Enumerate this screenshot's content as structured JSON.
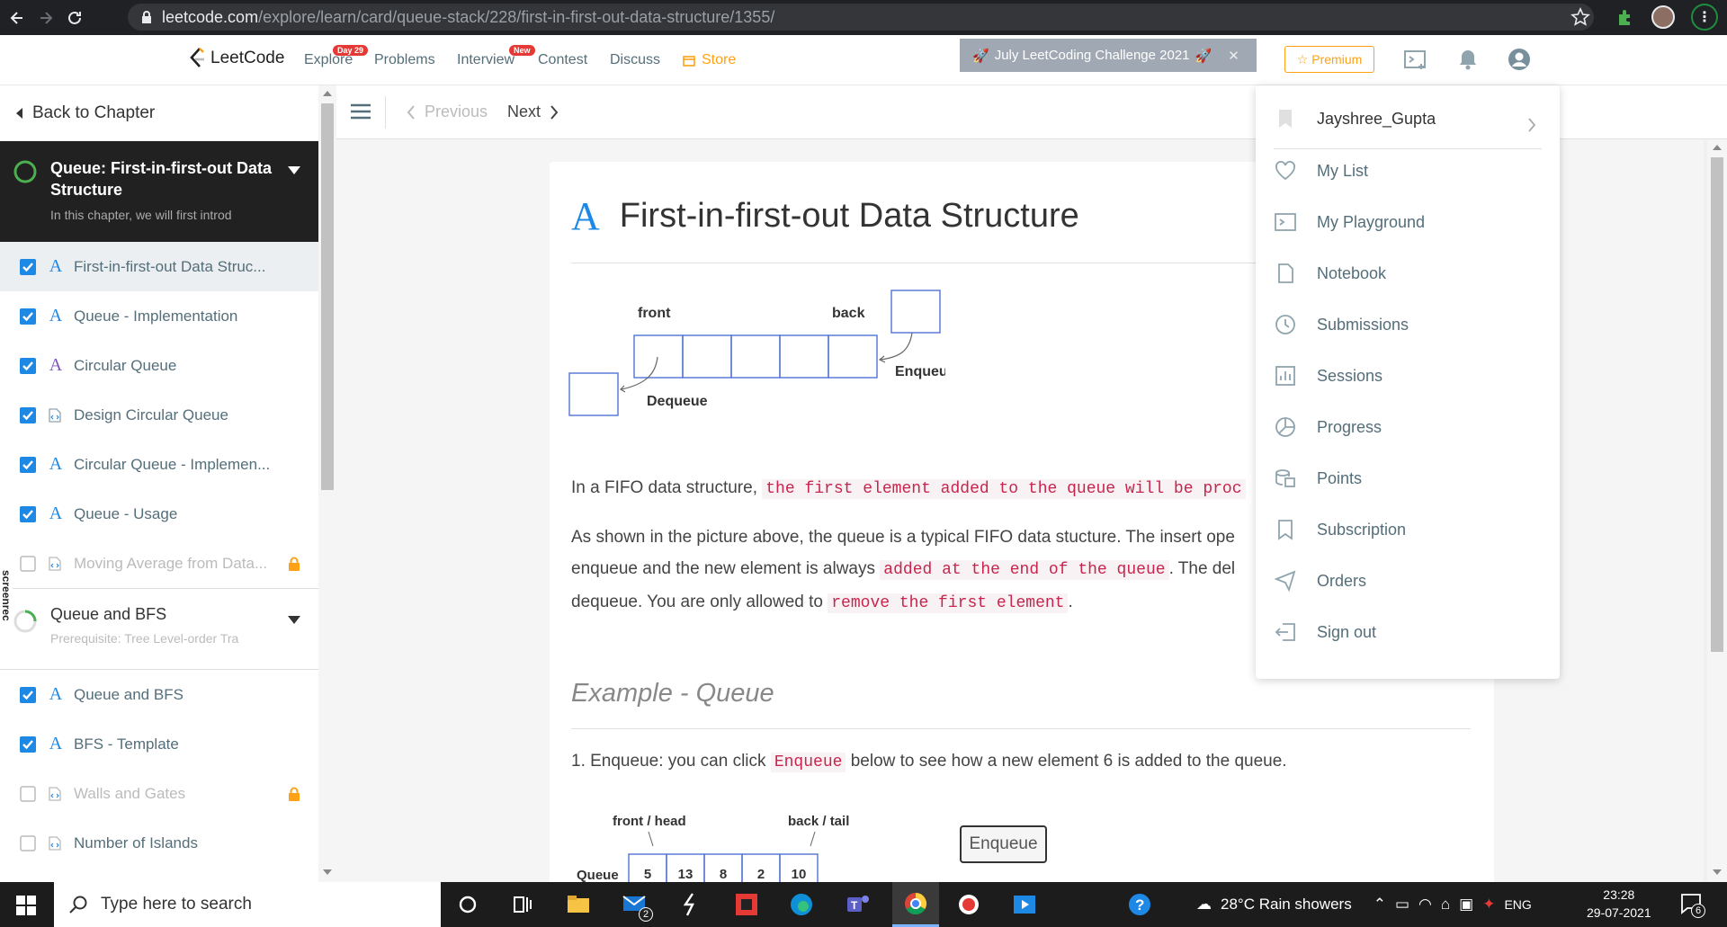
{
  "browser": {
    "url_host": "leetcode.com",
    "url_path": "/explore/learn/card/queue-stack/228/first-in-first-out-data-structure/1355/"
  },
  "nav": {
    "logo": "LeetCode",
    "items": [
      {
        "label": "Explore",
        "badge": "Day 29"
      },
      {
        "label": "Problems"
      },
      {
        "label": "Interview",
        "badge": "New"
      },
      {
        "label": "Contest"
      },
      {
        "label": "Discuss"
      },
      {
        "label": "Store"
      }
    ],
    "challenge": "July LeetCoding Challenge 2021",
    "premium": "Premium"
  },
  "sidebar": {
    "back": "Back to Chapter",
    "chapter_title": "Queue: First-in-first-out Data Structure",
    "chapter_sub": "In this chapter, we will first introd",
    "items": [
      {
        "label": "First-in-first-out Data Struc...",
        "checked": true,
        "type": "article"
      },
      {
        "label": "Queue - Implementation",
        "checked": true,
        "type": "article"
      },
      {
        "label": "Circular Queue",
        "checked": true,
        "type": "article"
      },
      {
        "label": "Design Circular Queue",
        "checked": true,
        "type": "code"
      },
      {
        "label": "Circular Queue - Implemen...",
        "checked": true,
        "type": "article"
      },
      {
        "label": "Queue - Usage",
        "checked": true,
        "type": "article"
      },
      {
        "label": "Moving Average from Data...",
        "checked": false,
        "type": "code",
        "locked": true
      }
    ],
    "section2_title": "Queue and BFS",
    "section2_sub": "Prerequisite: Tree Level-order Tra",
    "items2": [
      {
        "label": "Queue and BFS",
        "checked": true,
        "type": "article"
      },
      {
        "label": "BFS - Template",
        "checked": true,
        "type": "article"
      },
      {
        "label": "Walls and Gates",
        "checked": false,
        "type": "code",
        "locked": true
      },
      {
        "label": "Number of Islands",
        "checked": false,
        "type": "code"
      }
    ]
  },
  "toolbar": {
    "previous": "Previous",
    "next": "Next"
  },
  "article": {
    "title": "First-in-first-out Data Structure",
    "diagram": {
      "front": "front",
      "back": "back",
      "enqueue": "Enqueue",
      "dequeue": "Dequeue"
    },
    "p1_text": "In a FIFO data structure,",
    "p1_code": "the first element added to the queue will be proc",
    "p2_line1": "As shown in the picture above, the queue is a typical FIFO data stucture. The insert ope",
    "p2_line2_a": "enqueue and the new element is always",
    "p2_line2_code": "added at the end of the queue",
    "p2_line2_b": ". The del",
    "p2_line3_a": "dequeue. You are only allowed to",
    "p2_line3_code": "remove the first element",
    "p2_line3_b": ".",
    "example_heading": "Example - Queue",
    "step1_a": "1. Enqueue: you can click",
    "step1_code": "Enqueue",
    "step1_b": "below to see how a new element 6 is added to the queue.",
    "queue_front": "front / head",
    "queue_back": "back / tail",
    "queue_label": "Queue",
    "queue_values": [
      "5",
      "13",
      "8",
      "2",
      "10"
    ],
    "enqueue_button": "Enqueue"
  },
  "dropdown": {
    "username": "Jayshree_Gupta",
    "items": [
      "My List",
      "My Playground",
      "Notebook",
      "Submissions",
      "Sessions",
      "Progress",
      "Points",
      "Subscription",
      "Orders",
      "Sign out"
    ]
  },
  "taskbar": {
    "search_placeholder": "Type here to search",
    "weather": "28°C  Rain showers",
    "lang": "ENG",
    "time": "23:28",
    "date": "29-07-2021",
    "notif_count": "6",
    "mail_count": "2"
  },
  "screenrec": "screenrec",
  "colors": {
    "accent": "#1e88e5",
    "brand": "#ffa116",
    "code": "#c7254e"
  }
}
